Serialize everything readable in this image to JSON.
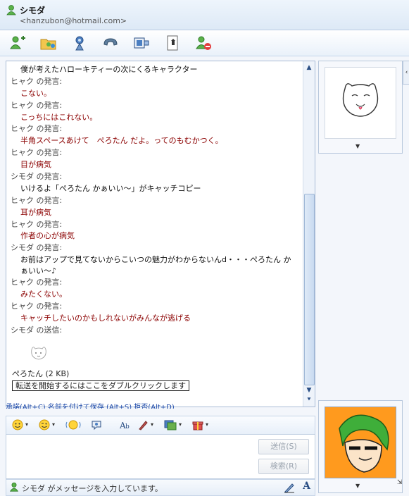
{
  "header": {
    "name": "シモダ",
    "email": "<hanzubon@hotmail.com>"
  },
  "toolbar": {
    "buttons": [
      "add-contact-icon",
      "share-folder-icon",
      "video-call-icon",
      "phone-icon",
      "activities-icon",
      "games-icon",
      "block-icon"
    ]
  },
  "conversation": {
    "lines": [
      {
        "kind": "msg",
        "style": "black",
        "text": "僕が考えたハローキティーの次にくるキャラクター"
      },
      {
        "kind": "speaker",
        "text": "ヒャク の発言:"
      },
      {
        "kind": "msg",
        "style": "red",
        "text": "こない。"
      },
      {
        "kind": "speaker",
        "text": "ヒャク の発言:"
      },
      {
        "kind": "msg",
        "style": "red",
        "text": "こっちにはこれない。"
      },
      {
        "kind": "speaker",
        "text": "ヒャク の発言:"
      },
      {
        "kind": "msg",
        "style": "red",
        "text": "半角スペースあけて　ぺろたん だよ。ってのもむかつく。"
      },
      {
        "kind": "speaker",
        "text": "ヒャク の発言:"
      },
      {
        "kind": "msg",
        "style": "red",
        "text": "目が病気"
      },
      {
        "kind": "speaker",
        "text": "シモダ の発言:"
      },
      {
        "kind": "msg",
        "style": "black",
        "text": "いけるよ「ぺろたん かぁいい～」がキャッチコピー"
      },
      {
        "kind": "speaker",
        "text": "ヒャク の発言:"
      },
      {
        "kind": "msg",
        "style": "red",
        "text": "耳が病気"
      },
      {
        "kind": "speaker",
        "text": "ヒャク の発言:"
      },
      {
        "kind": "msg",
        "style": "red",
        "text": "作者の心が病気"
      },
      {
        "kind": "speaker",
        "text": "シモダ の発言:"
      },
      {
        "kind": "msg",
        "style": "black",
        "text": "お前はアップで見てないからこいつの魅力がわからないんd・・・ぺろたん かぁいい～♪"
      },
      {
        "kind": "speaker",
        "text": "ヒャク の発言:"
      },
      {
        "kind": "msg",
        "style": "red",
        "text": "みたくない。"
      },
      {
        "kind": "speaker",
        "text": "ヒャク の発言:"
      },
      {
        "kind": "msg",
        "style": "red",
        "text": "キャッチしたいのかもしれないがみんなが逃げる"
      },
      {
        "kind": "speaker",
        "text": "シモダ の送信:"
      }
    ],
    "file": {
      "name": "ぺろたん (2 KB)",
      "transfer_prompt": "転送を開始するにはここをダブルクリックします"
    },
    "links": "承諾(Alt+C)  名前を付けて保存 (Alt+S)  拒否(Alt+D)"
  },
  "compose": {
    "send_label": "送信(S)",
    "search_label": "検索(R)"
  },
  "status": {
    "text": "シモダ がメッセージを入力しています。"
  },
  "colors": {
    "received": "#8b0000",
    "sent": "#111111",
    "link": "#1a47a8"
  }
}
